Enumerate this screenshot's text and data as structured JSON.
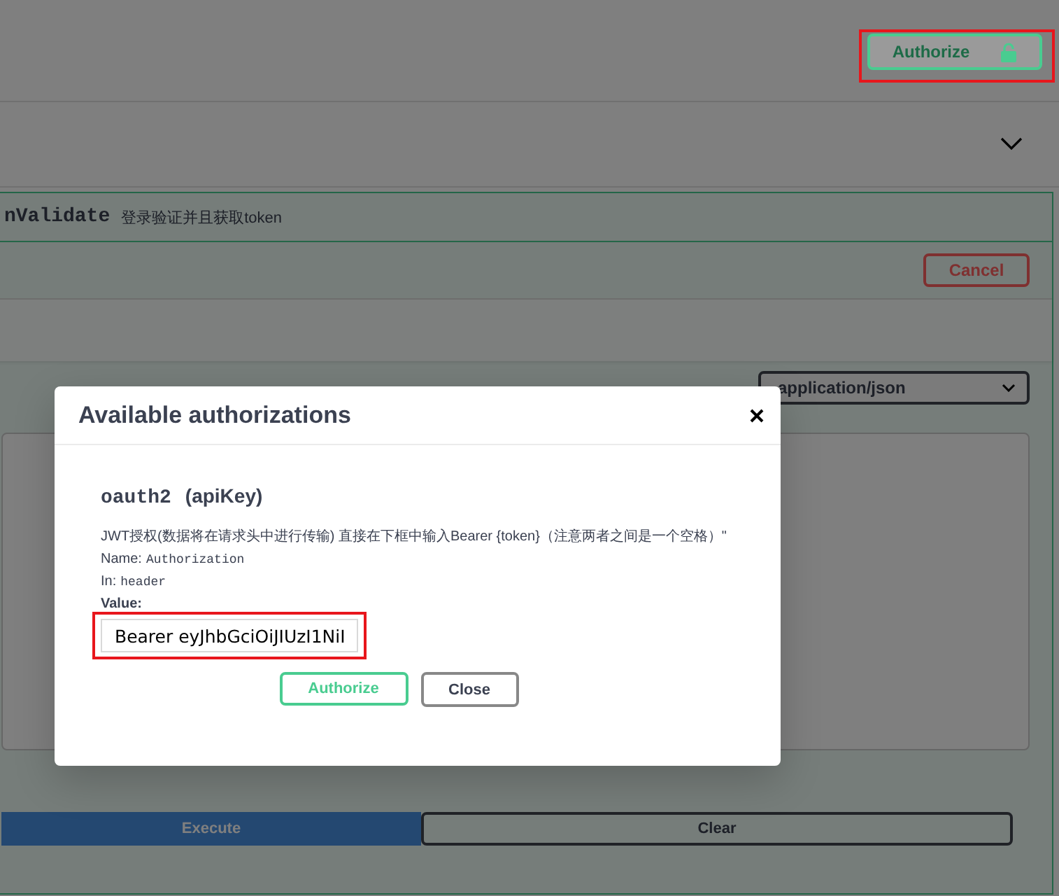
{
  "topbar": {
    "authorize_button": "Authorize"
  },
  "operation": {
    "path": "nValidate",
    "summary": "登录验证并且获取token",
    "cancel_button": "Cancel",
    "content_type": "application/json",
    "execute_button": "Execute",
    "clear_button": "Clear"
  },
  "modal": {
    "title": "Available authorizations",
    "scheme": "oauth2",
    "scheme_type": "(apiKey)",
    "description": "JWT授权(数据将在请求头中进行传输) 直接在下框中输入Bearer {token}（注意两者之间是一个空格）\"",
    "name_label": "Name:",
    "name_value": "Authorization",
    "in_label": "In:",
    "in_value": "header",
    "value_label": "Value:",
    "value": "Bearer eyJhbGciOiJIUzI1NiI",
    "authorize_button": "Authorize",
    "close_button": "Close"
  }
}
